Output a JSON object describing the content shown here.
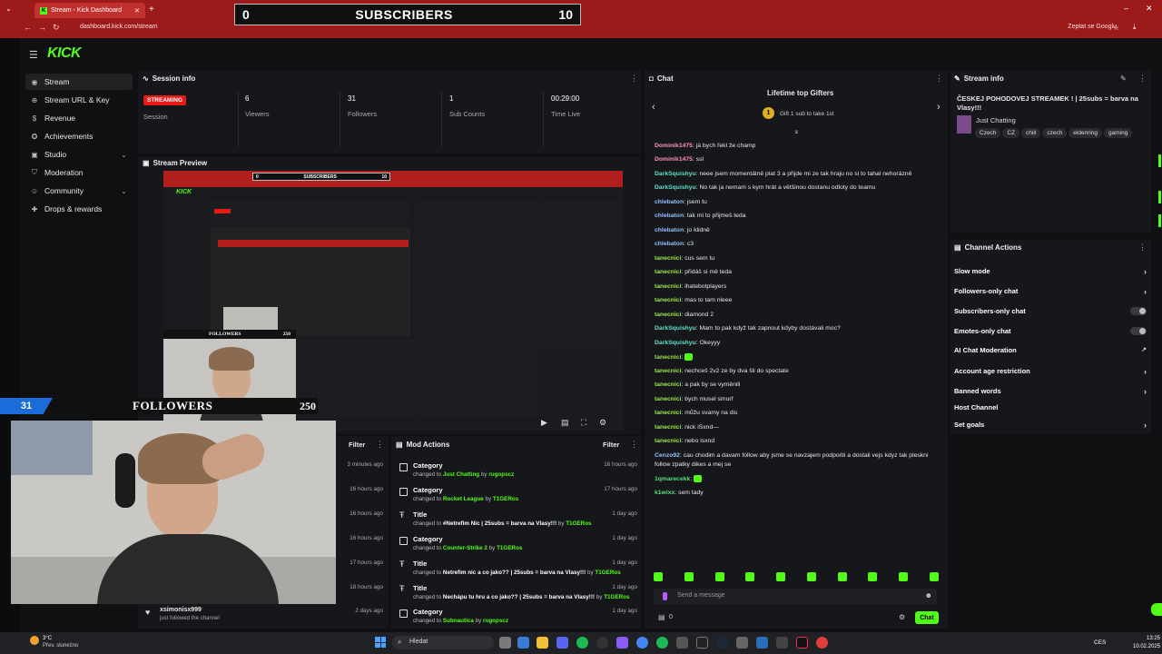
{
  "browser": {
    "tab_title": "Stream - Kick Dashboard",
    "url": "dashboard.kick.com/stream",
    "google_label": "Zeptat se Googlu"
  },
  "subs_overlay": {
    "left": "0",
    "title": "SUBSCRIBERS",
    "right": "10"
  },
  "sidebar": {
    "logo": "KICK",
    "items": [
      {
        "label": "Stream",
        "icon": "broadcast-icon"
      },
      {
        "label": "Stream URL & Key",
        "icon": "globe-icon"
      },
      {
        "label": "Revenue",
        "icon": "dollar-icon"
      },
      {
        "label": "Achievements",
        "icon": "badge-icon"
      },
      {
        "label": "Studio",
        "icon": "studio-icon"
      },
      {
        "label": "Moderation",
        "icon": "shield-icon"
      },
      {
        "label": "Community",
        "icon": "people-icon"
      },
      {
        "label": "Drops & rewards",
        "icon": "gift-icon"
      }
    ]
  },
  "session": {
    "title": "Session info",
    "status": "STREAMING",
    "status_label": "Session",
    "stats": [
      {
        "value": "6",
        "label": "Viewers"
      },
      {
        "value": "31",
        "label": "Followers"
      },
      {
        "value": "1",
        "label": "Sub Counts"
      },
      {
        "value": "00:29:00",
        "label": "Time Live"
      }
    ]
  },
  "preview": {
    "title": "Stream Preview",
    "nested_subs": {
      "left": "0",
      "title": "SUBSCRIBERS",
      "right": "10"
    },
    "nested_followers": "FOLLOWERS",
    "nested_goal": "250"
  },
  "followers_overlay": {
    "count": "31",
    "label": "FOLLOWERS",
    "goal": "250"
  },
  "activity": {
    "filter": "Filter",
    "times": [
      "3 minutes ago",
      "16 hours ago",
      "16 hours ago",
      "16 hours ago",
      "17 hours ago",
      "18 hours ago",
      "2 days ago"
    ],
    "follow_user": "xsimonisx999",
    "follow_text": "just followed the channel"
  },
  "mod_actions": {
    "title": "Mod Actions",
    "filter": "Filter",
    "rows": [
      {
        "type": "Category",
        "prefix": "changed to ",
        "value": "Just Chatting",
        "by": " by ",
        "user": "rugopscz",
        "time": "16 hours ago"
      },
      {
        "type": "Category",
        "prefix": "changed to ",
        "value": "Rocket League",
        "by": " by ",
        "user": "T1GERos",
        "time": "17 hours ago"
      },
      {
        "type": "Title",
        "prefix": "changed to ",
        "value": "#Netrefim Nic | 25subs = barva na Vlasy!!!",
        "by": " by ",
        "user": "T1GERos",
        "time": "1 day ago"
      },
      {
        "type": "Category",
        "prefix": "changed to ",
        "value": "Counter-Strike 2",
        "by": " by ",
        "user": "T1GERos",
        "time": "1 day ago"
      },
      {
        "type": "Title",
        "prefix": "changed to ",
        "value": "Netrefim nic a co jako?? | 25subs = barva na Vlasy!!!",
        "by": " by ",
        "user": "T1GERos",
        "time": "1 day ago"
      },
      {
        "type": "Title",
        "prefix": "changed to ",
        "value": "Nechápu tu hru a co jako?? | 25subs = barva na Vlasy!!!",
        "by": " by ",
        "user": "T1GERos",
        "time": "1 day ago"
      },
      {
        "type": "Category",
        "prefix": "changed to ",
        "value": "Subnautica",
        "by": " by ",
        "user": "rugopscz",
        "time": "1 day ago"
      }
    ]
  },
  "chat": {
    "title": "Chat",
    "gifters_title": "Lifetime top Gifters",
    "gifters_sub": "Gift 1 sub to take 1st",
    "gifter_rank": "1",
    "messages": [
      {
        "user": "Dominik1475",
        "cls": "u-pink",
        "text": ": já bych řekl že champ"
      },
      {
        "user": "Dominik1475",
        "cls": "u-pink",
        "text": ": ssl"
      },
      {
        "user": "DarkSquishyu",
        "cls": "u-teal",
        "text": ": neee jsem momentálně plat 3 a přijde mi ze tak hraju no si to tahal nehorázně"
      },
      {
        "user": "DarkSquishyu",
        "cls": "u-teal",
        "text": ": No tak ja nemam s kym hrát a většinou dostanu odloty do teamu"
      },
      {
        "user": "chlebaton",
        "cls": "u-blue",
        "text": ": jsem tu"
      },
      {
        "user": "chlebaton",
        "cls": "u-blue",
        "text": ": tak mi to přijmeš teda"
      },
      {
        "user": "chlebaton",
        "cls": "u-blue",
        "text": ": jo klidně"
      },
      {
        "user": "chlebaton",
        "cls": "u-blue",
        "text": ": c3"
      },
      {
        "user": "tanecnici",
        "cls": "u-lime",
        "text": ": cus sem tu"
      },
      {
        "user": "tanecnici",
        "cls": "u-lime",
        "text": ": přidáš si mě teda"
      },
      {
        "user": "tanecnici",
        "cls": "u-lime",
        "text": ": ihatebotplayers"
      },
      {
        "user": "tanecnici",
        "cls": "u-lime",
        "text": ": mas to tam nleee"
      },
      {
        "user": "tanecnici",
        "cls": "u-lime",
        "text": ": diamond 2"
      },
      {
        "user": "DarkSquishyu",
        "cls": "u-teal",
        "text": ": Mam to pak když tak zapnout kdyby dostávali moc?"
      },
      {
        "user": "DarkSquishyu",
        "cls": "u-teal",
        "text": ": Okeyyy"
      },
      {
        "user": "tanecnici",
        "cls": "u-lime",
        "text": ": "
      },
      {
        "user": "tanecnici",
        "cls": "u-lime",
        "text": ": nechceš 2v2 ze by dva šli do spectate"
      },
      {
        "user": "tanecnici",
        "cls": "u-lime",
        "text": ": a pak by se vyměnili"
      },
      {
        "user": "tanecnici",
        "cls": "u-lime",
        "text": ": bych musel smurf"
      },
      {
        "user": "tanecnici",
        "cls": "u-lime",
        "text": ": můžu svamy na dis"
      },
      {
        "user": "tanecnici",
        "cls": "u-lime",
        "text": ": nick iSxnd—"
      },
      {
        "user": "tanecnici",
        "cls": "u-lime",
        "text": ": nebo isxnd"
      },
      {
        "user": "Cenzo92",
        "cls": "u-blue",
        "text": ": cau chodim a davam follow aby jsme se navzajem podporili a dostali vejs kdyz tak pleskni"
      },
      {
        "user": "",
        "cls": "",
        "text": "follow zpatky dikes a mej se"
      },
      {
        "user": "1qmarecekk",
        "cls": "u-green",
        "text": ": "
      },
      {
        "user": "k1wixx",
        "cls": "u-green",
        "text": ": sem tady"
      }
    ],
    "input_placeholder": "Send a message",
    "count": "0",
    "send_label": "Chat"
  },
  "stream_info": {
    "title": "Stream info",
    "stream_title": "ČESKEJ POHODOVEJ STREAMEK ! | 25subs = barva na Vlasy!!!",
    "category": "Just Chatting",
    "tags": [
      "Czech",
      "CZ",
      "chill",
      "czech",
      "eldenring",
      "gaming"
    ]
  },
  "channel_actions": {
    "title": "Channel Actions",
    "rows": [
      {
        "label": "Slow mode",
        "control": "chevron"
      },
      {
        "label": "Followers-only chat",
        "control": "chevron"
      },
      {
        "label": "Subscribers-only chat",
        "control": "toggle"
      },
      {
        "label": "Emotes-only chat",
        "control": "toggle"
      },
      {
        "label": "AI Chat Moderation",
        "control": "external"
      },
      {
        "label": "Account age restriction",
        "control": "chevron"
      },
      {
        "label": "Banned words",
        "control": "chevron"
      },
      {
        "label": "Host Channel",
        "control": "none"
      },
      {
        "label": "Set goals",
        "control": "chevron"
      }
    ]
  },
  "taskbar": {
    "weather_temp": "3°C",
    "weather_text": "Přev. slunečno",
    "search": "Hledat",
    "lang": "CES",
    "time": "13:25",
    "date": "10.02.2025"
  },
  "colors": {
    "accent": "#53fc18",
    "browser_red": "#9c1a1a",
    "live": "#e91916"
  }
}
